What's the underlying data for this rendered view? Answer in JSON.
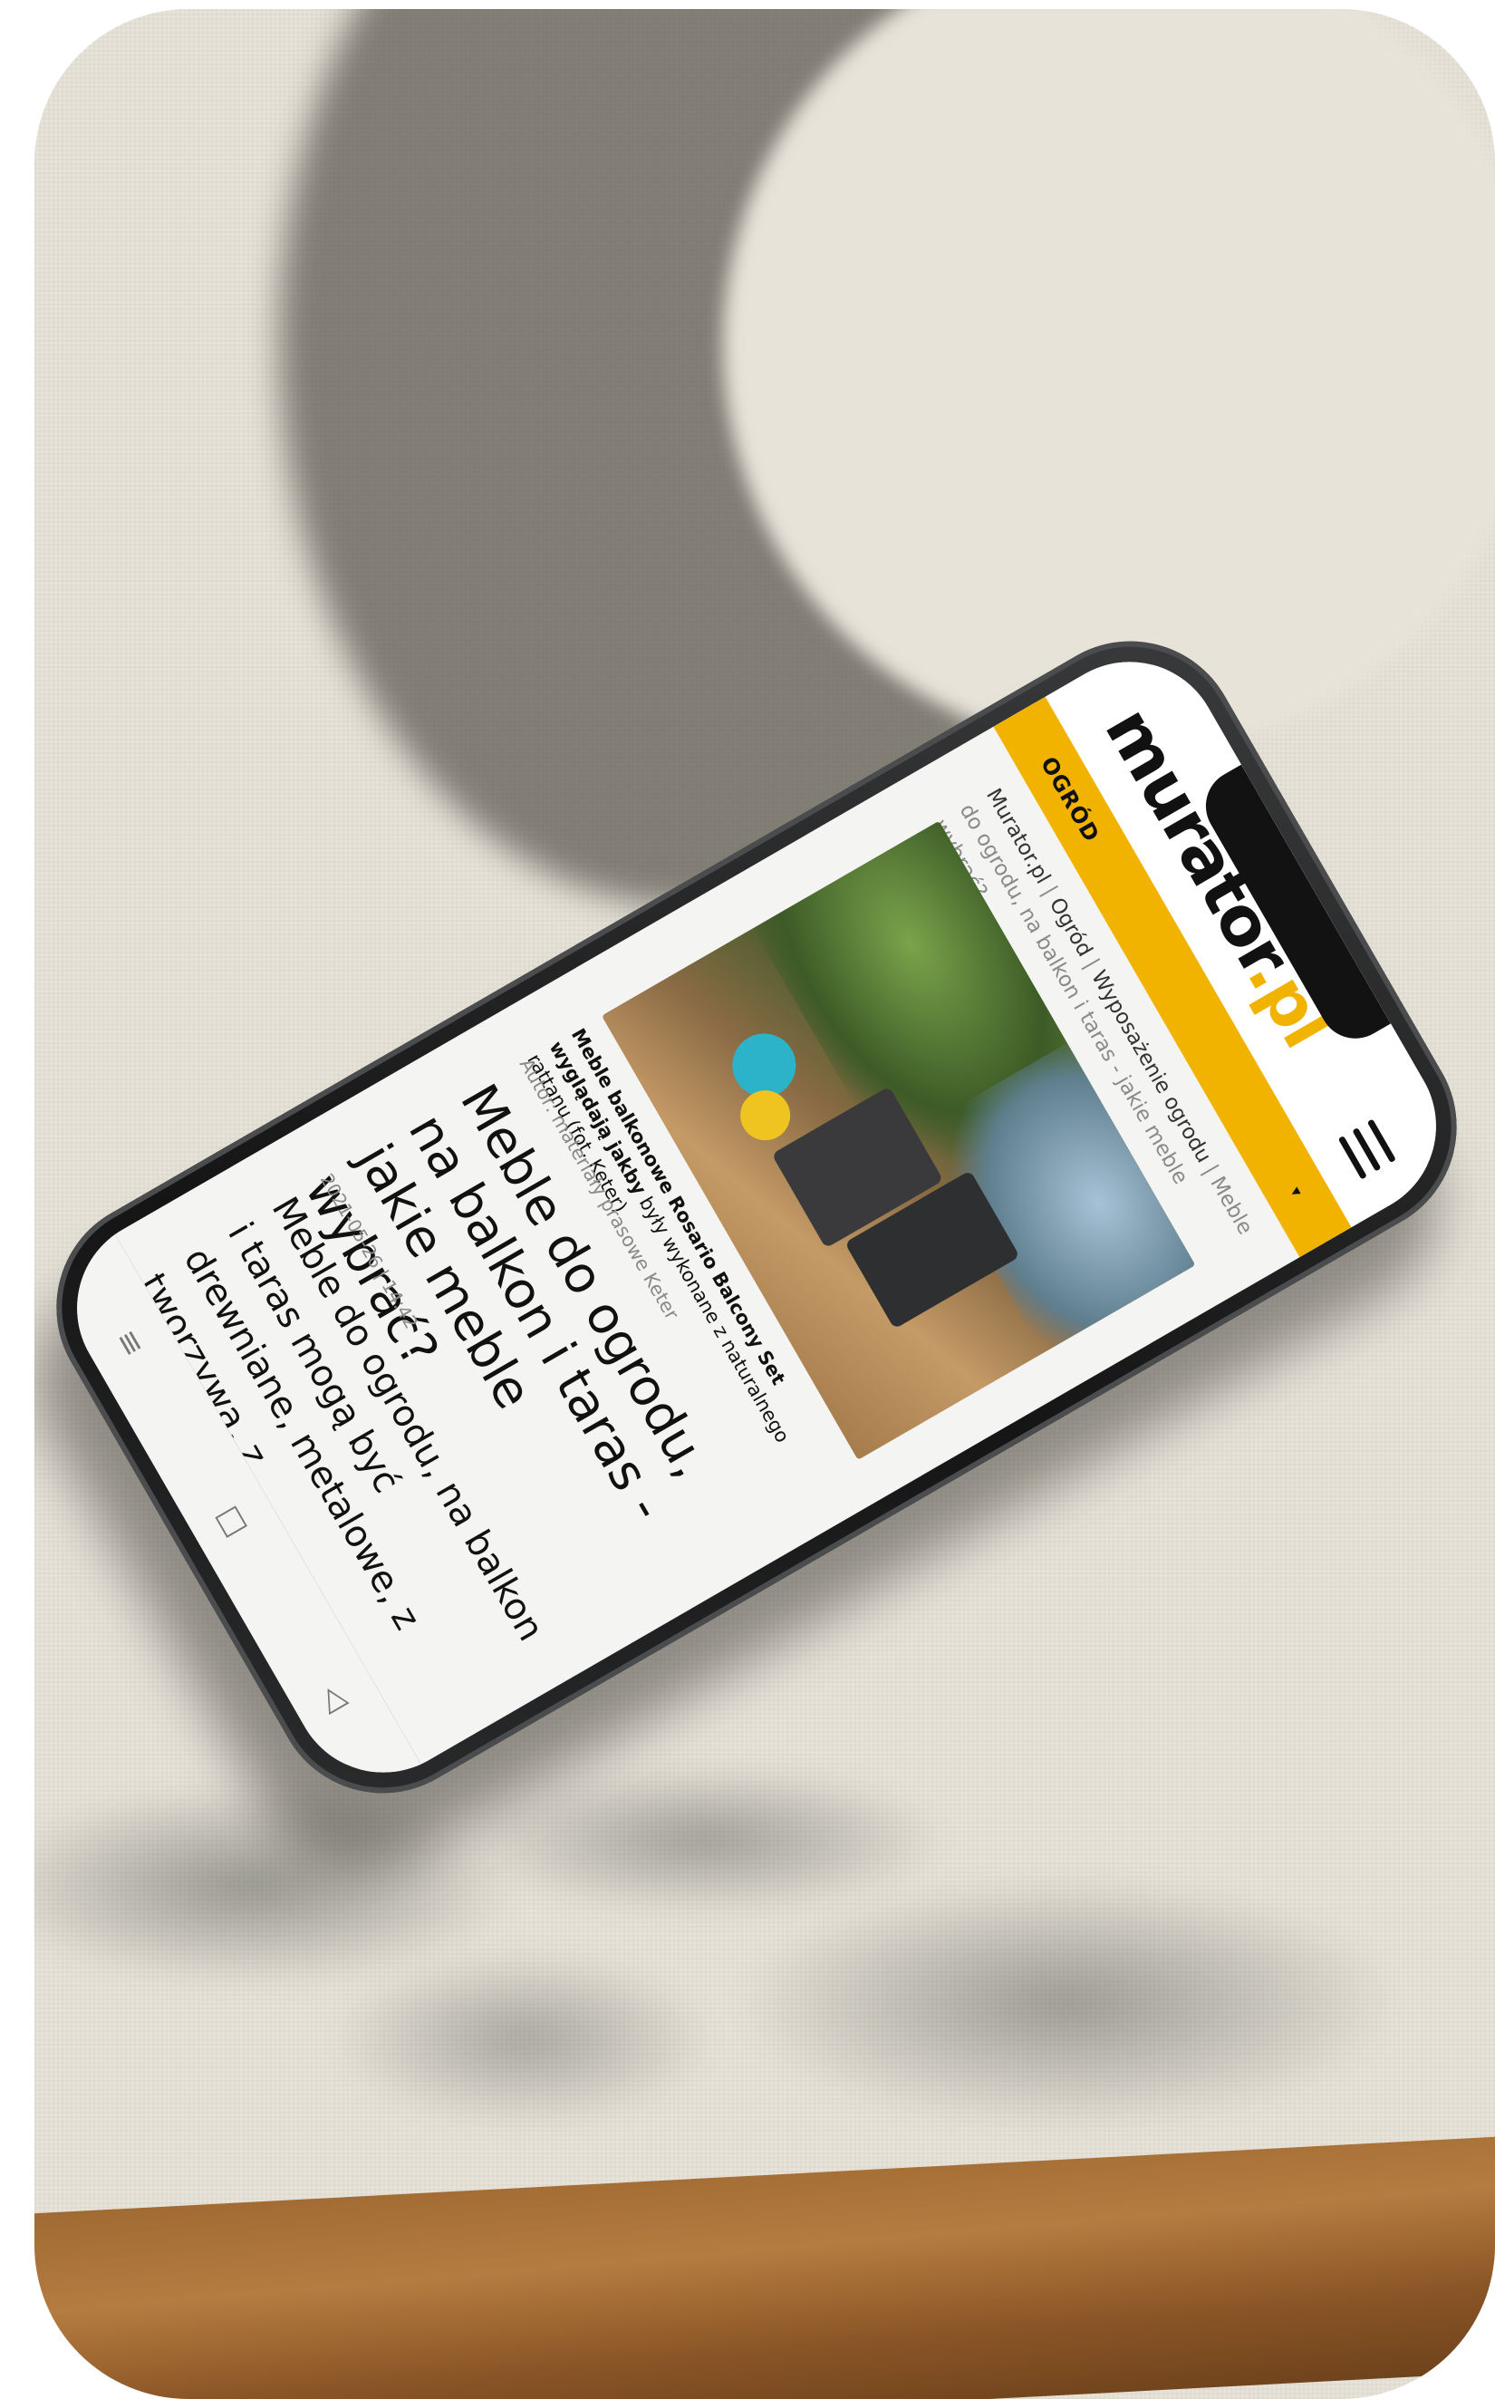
{
  "site": {
    "logo_main": "murator",
    "logo_dot": ".pl",
    "category": "OGRÓD"
  },
  "breadcrumb": {
    "items": [
      "Murator.pl",
      "Ogród",
      "Wyposażenie ogrodu"
    ],
    "separator": "|",
    "current": "Meble do ogrodu, na balkon i taras - jakie meble wybrać?"
  },
  "article": {
    "caption_bold": "Meble balkonowe Rosario Balcony Set wyglądają jakby",
    "caption_rest": "były wykonane z naturalnego rattanu (fot. Keter)",
    "author": "Autor: materiały prasowe Keter",
    "title": "Meble do ogrodu, na balkon i taras - jakie meble wybrać?",
    "date": "2021-05-26",
    "time": "14:42",
    "date_sep": "|",
    "lead": "Meble do ogrodu, na balkon i taras mogą być drewniane, metalowe, z tworzywa, z"
  },
  "icons": {
    "menu": "hamburger-menu-icon",
    "caret": "caret-down-icon",
    "nav_recent": "recent-apps-icon",
    "nav_home": "home-icon",
    "nav_back": "back-icon"
  },
  "nav_glyphs": {
    "recent": "≡",
    "home": "□",
    "back": "◁",
    "caret": "▾"
  },
  "colors": {
    "accent": "#f2b300",
    "text": "#111111",
    "muted": "#8a8a8a"
  }
}
